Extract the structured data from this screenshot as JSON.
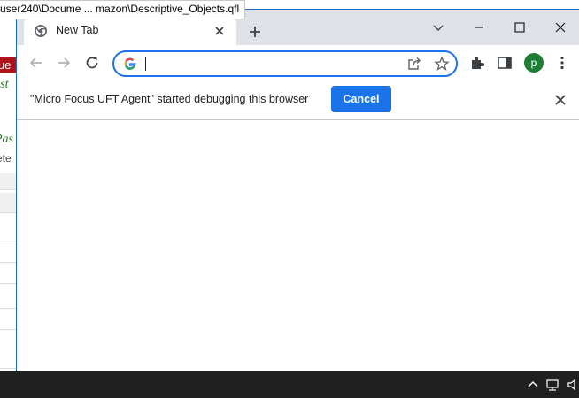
{
  "background_app": {
    "title": "user240\\Docume ... mazon\\Descriptive_Objects.qfl",
    "badge_text": "lue",
    "green_text_1": "est",
    "green_text_2": "Pas",
    "gray_text": "ete"
  },
  "browser": {
    "tab": {
      "title": "New Tab"
    },
    "address_bar": {
      "value": "",
      "placeholder": ""
    },
    "profile_initial": "p",
    "infobar": {
      "message": "\"Micro Focus UFT Agent\" started debugging this browser",
      "cancel_label": "Cancel"
    }
  },
  "colors": {
    "accent": "#1a73e8",
    "avatar": "#1e7e34",
    "badge": "#b0131b"
  }
}
